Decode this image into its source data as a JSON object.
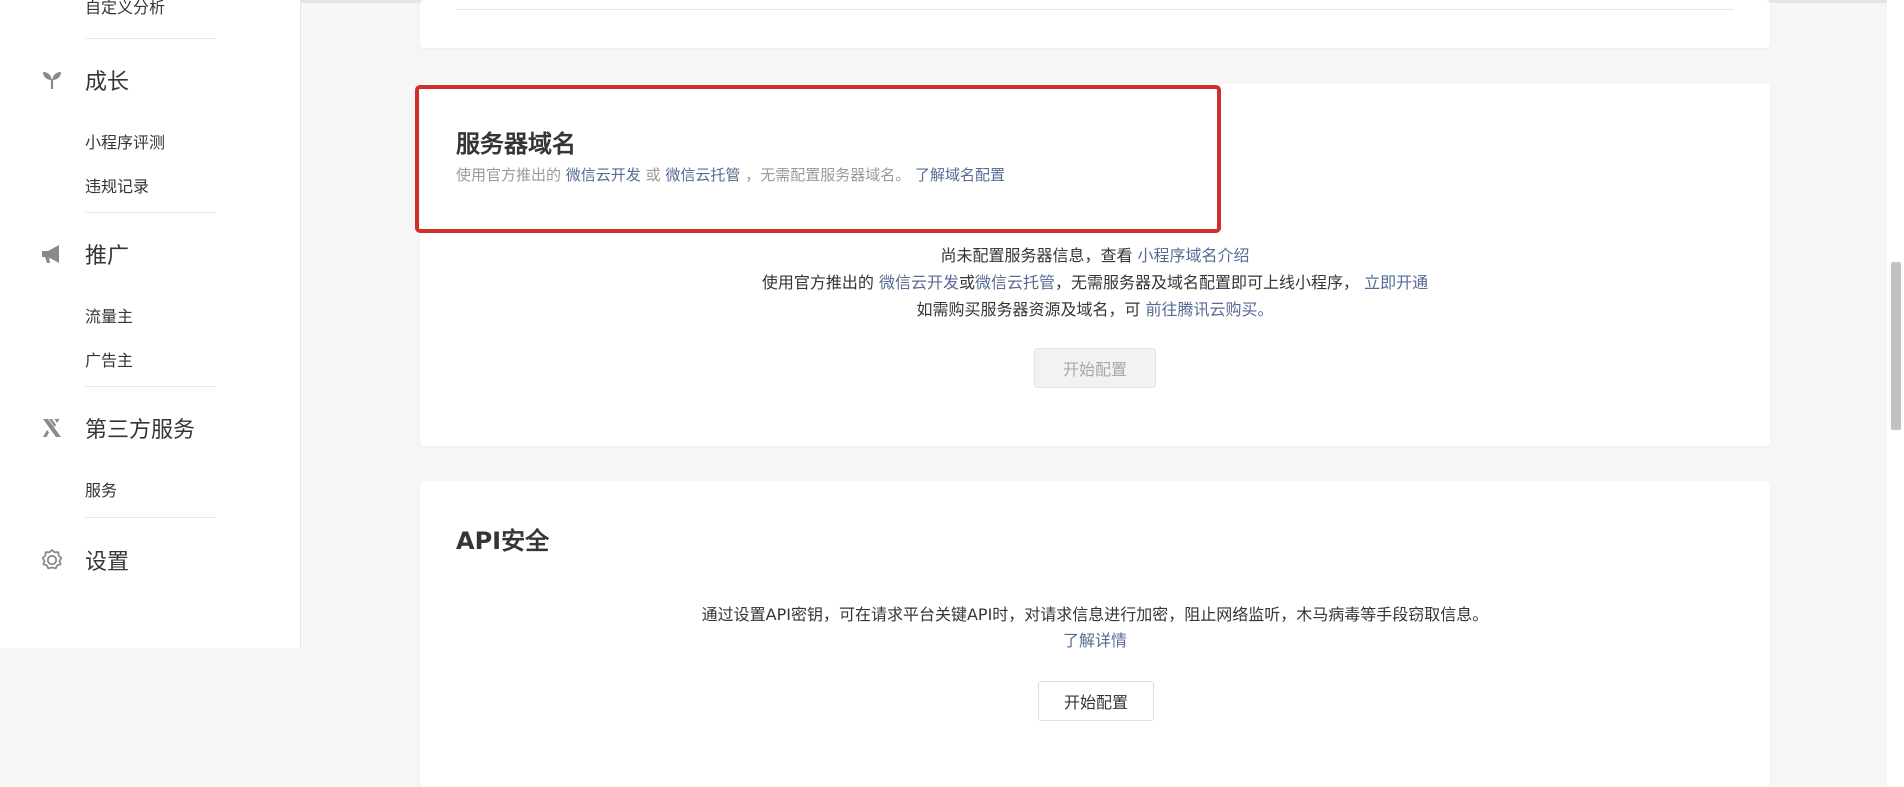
{
  "sidebar": {
    "cut_item": "自定义分析",
    "groups": [
      {
        "icon": "sprout-icon",
        "label": "成长",
        "items": [
          "小程序评测",
          "违规记录"
        ]
      },
      {
        "icon": "megaphone-icon",
        "label": "推广",
        "items": [
          "流量主",
          "广告主"
        ]
      },
      {
        "icon": "third-party-icon",
        "label": "第三方服务",
        "items": [
          "服务"
        ]
      },
      {
        "icon": "gear-icon",
        "label": "设置",
        "items": []
      }
    ]
  },
  "domain_card": {
    "title": "服务器域名",
    "desc_prefix": "使用官方推出的",
    "desc_link1": "微信云开发",
    "desc_or": "或",
    "desc_link2": "微信云托管",
    "desc_suffix": "，无需配置服务器域名。",
    "desc_link3": "了解域名配置",
    "line1_text": "尚未配置服务器信息，查看",
    "line1_link": "小程序域名介绍",
    "line2_prefix": "使用官方推出的",
    "line2_link1": "微信云开发",
    "line2_or": "或",
    "line2_link2": "微信云托管",
    "line2_suffix": "，无需服务器及域名配置即可上线小程序，",
    "line2_link3": "立即开通",
    "line3_text": "如需购买服务器资源及域名，可",
    "line3_link": "前往腾讯云购买。",
    "button": "开始配置"
  },
  "api_card": {
    "title": "API安全",
    "desc": "通过设置API密钥，可在请求平台关键API时，对请求信息进行加密，阻止网络监听，木马病毒等手段窃取信息。",
    "link": "了解详情",
    "button": "开始配置"
  },
  "colors": {
    "link": "#576b95",
    "highlight": "#d0302c",
    "text": "#353535",
    "muted": "#9a9a9a"
  }
}
